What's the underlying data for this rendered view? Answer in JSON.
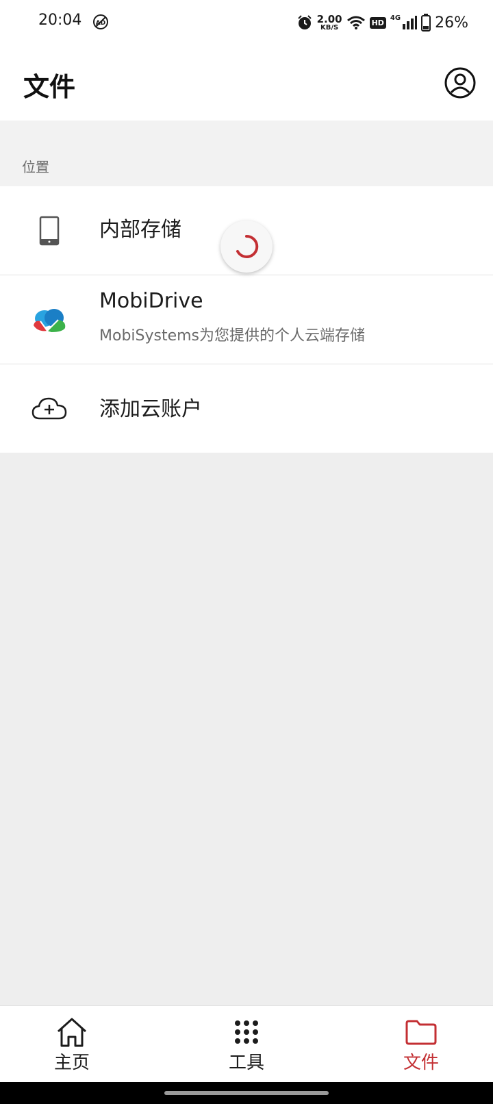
{
  "status_bar": {
    "time": "20:04",
    "net_speed_value": "2.00",
    "net_speed_unit": "KB/S",
    "hd": "HD",
    "network": "4G",
    "battery": "26%"
  },
  "header": {
    "title": "文件"
  },
  "section": {
    "label": "位置"
  },
  "locations": [
    {
      "title": "内部存储",
      "subtitle": ""
    },
    {
      "title": "MobiDrive",
      "subtitle": "MobiSystems为您提供的个人云端存储"
    },
    {
      "title": "添加云账户",
      "subtitle": ""
    }
  ],
  "bottom_nav": [
    {
      "label": "主页",
      "icon": "home-icon"
    },
    {
      "label": "工具",
      "icon": "grid-icon"
    },
    {
      "label": "文件",
      "icon": "folder-icon",
      "active": true
    }
  ],
  "colors": {
    "accent": "#c32f33",
    "background": "#eeeeee"
  }
}
